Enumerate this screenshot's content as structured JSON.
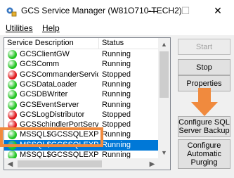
{
  "window": {
    "title": "GCS Service Manager (W81O710-TECH2)",
    "minimize_glyph": "—",
    "maximize_glyph": "☐",
    "close_glyph": "✕"
  },
  "menu": {
    "items": [
      "Utilities",
      "Help"
    ]
  },
  "list": {
    "columns": [
      "Service Description",
      "Status"
    ],
    "rows": [
      {
        "name": "GCSClientGW",
        "status": "Running",
        "color": "#21c421"
      },
      {
        "name": "GCSComm",
        "status": "Running",
        "color": "#21c421"
      },
      {
        "name": "GCSCommanderService",
        "status": "Stopped",
        "color": "#e0161c"
      },
      {
        "name": "GCSDataLoader",
        "status": "Running",
        "color": "#21c421"
      },
      {
        "name": "GCSDBWriter",
        "status": "Running",
        "color": "#21c421"
      },
      {
        "name": "GCSEventServer",
        "status": "Running",
        "color": "#21c421"
      },
      {
        "name": "GCSLogDistributor",
        "status": "Stopped",
        "color": "#e0161c"
      },
      {
        "name": "GCSSchindlerPortService",
        "status": "Stopped",
        "color": "#e0161c"
      },
      {
        "name": "MSSQL$GCSSQLEXPR...",
        "status": "Running",
        "color": "#21c421"
      },
      {
        "name": "MSSQL$GCSSQLEXPR...",
        "status": "Running",
        "color": "#21c421",
        "selected": true
      },
      {
        "name": "MSSQL$GCSSQLEXPR...",
        "status": "Running",
        "color": "#21c421"
      }
    ]
  },
  "buttons": {
    "start": "Start",
    "stop": "Stop",
    "properties": "Properties",
    "configure_sql_line1": "Configure SQL",
    "configure_sql_line2": "Server Backup",
    "configure_purge_line1": "Configure",
    "configure_purge_line2": "Automatic",
    "configure_purge_line3": "Purging"
  },
  "colors": {
    "annotation": "#f08a3e",
    "selection": "#0078d7",
    "running": "#21c421",
    "stopped": "#e0161c"
  }
}
